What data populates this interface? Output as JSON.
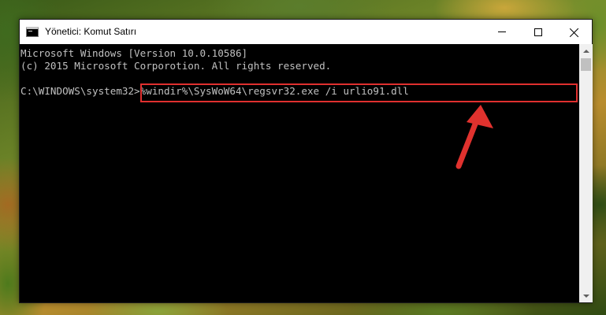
{
  "window": {
    "title": "Yönetici: Komut Satırı"
  },
  "console": {
    "lines": [
      "Microsoft Windows [Version 10.0.10586]",
      "(c) 2015 Microsoft Corporotion. All rights reserved."
    ],
    "prompt": "C:\\WINDOWS\\system32>",
    "command": "%windir%\\SysWoW64\\regsvr32.exe /i urlio91.dll"
  },
  "colors": {
    "console_bg": "#000000",
    "console_text": "#c0c0c0",
    "highlight": "#e0302f",
    "arrow": "#e0302f"
  },
  "icons": {
    "app": "cmd-icon",
    "minimize": "minimize-icon",
    "maximize": "maximize-icon",
    "close": "close-icon",
    "annotation": "red-arrow-icon"
  }
}
